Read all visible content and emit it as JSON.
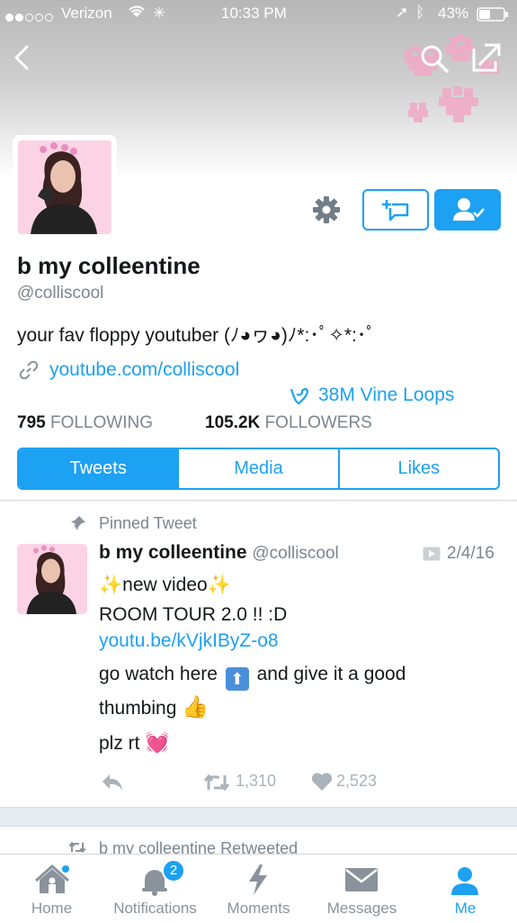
{
  "status": {
    "carrier": "Verizon",
    "time": "10:33 PM",
    "battery": "43%"
  },
  "profile": {
    "name": "b my colleentine",
    "handle": "@colliscool",
    "bio": "your fav floppy youtuber (ﾉ◕ヮ◕)ﾉ*:･ﾟ✧*:･ﾟ",
    "link": "youtube.com/colliscool",
    "vine": "38M Vine Loops",
    "following_count": "795",
    "following_label": "FOLLOWING",
    "followers_count": "105.2K",
    "followers_label": "FOLLOWERS"
  },
  "tabs": [
    "Tweets",
    "Media",
    "Likes"
  ],
  "pinned": {
    "label": "Pinned Tweet",
    "author": "b my colleentine",
    "handle": "@colliscool",
    "date": "2/4/16",
    "line1": "✨new video✨",
    "line2": "ROOM TOUR 2.0 !! :D",
    "link": "youtu.be/kVjkIByZ-o8",
    "line3a": "go watch here",
    "line3b": "and give it a good",
    "line4": "thumbing",
    "line5": "plz rt",
    "retweets": "1,310",
    "likes": "2,523"
  },
  "next": {
    "retweeted_label": "b my colleentine Retweeted"
  },
  "tabbar": {
    "home": "Home",
    "notifications": "Notifications",
    "notifications_badge": "2",
    "moments": "Moments",
    "messages": "Messages",
    "me": "Me"
  },
  "colors": {
    "accent": "#1da1f2",
    "muted": "#8a939b",
    "heart_pixel": "#f3a7c4"
  }
}
